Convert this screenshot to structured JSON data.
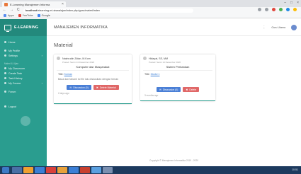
{
  "browser": {
    "tab_title": "E-Learning Manajemen Informa",
    "tab_close": "×",
    "window_controls": [
      "–",
      "□",
      "×"
    ],
    "nav": [
      "←",
      "→",
      "C"
    ],
    "url_host": "localhost",
    "url_path": "/elearning-mi-siswa/ajax/index.php/guru/materi/index",
    "bookmarks": [
      "Apps",
      "YouTube",
      "Google"
    ],
    "ext_colors": [
      "#9aa0a6",
      "#9aa0a6",
      "#e0463c",
      "#4caf50",
      "#1e88e5",
      "#fbbc04"
    ]
  },
  "sidebar": {
    "logo_text": "E-LEARNING",
    "items_top": [
      {
        "label": "Home"
      }
    ],
    "group_personal": [
      {
        "label": "My Profile"
      },
      {
        "label": "Settings"
      }
    ],
    "group_head": "Materi & Ujian",
    "group_learning": [
      {
        "label": "My Classroom"
      },
      {
        "label": "Create Task"
      },
      {
        "label": "Task History"
      },
      {
        "label": "My Course"
      }
    ],
    "items_misc": [
      {
        "label": "Forum"
      }
    ],
    "items_bottom": [
      {
        "label": "Logout"
      }
    ],
    "chevron": "›"
  },
  "topbar": {
    "title": "MANAJEMEN INFORMATIKA",
    "menu": "⋮",
    "user_name": "Guru Utama"
  },
  "main": {
    "page_title": "Material"
  },
  "cards": [
    {
      "author": "Nashrudin Zidan, M.Kom",
      "date": "Posted: Senin 14 Desember 2020",
      "subject": "Komputer dan Masyarakat",
      "file_label": "Title:",
      "file_link": "Komas",
      "desc": "Baca dan fahami isi file lalu diskusikan dengan teman",
      "btn_primary": "Discussion (0)",
      "btn_danger": "Delete Material",
      "time": "2 days ago"
    },
    {
      "author": "Hidayat, SE, MM",
      "date": "Posted: Senin 14 Desember 2020",
      "subject": "Sistem Perbankan",
      "file_label": "Title:",
      "file_link": "Modul 1",
      "desc": "",
      "btn_primary": "Discussion (0)",
      "btn_danger": "Delete",
      "time": "3 months ago"
    }
  ],
  "footer": {
    "text": "Copyright © Manajemen Informatika 2019 - 2020"
  },
  "taskbar": {
    "icon_colors": [
      "#4a6fa5",
      "#f0a030",
      "#3b7fd6",
      "#d9413b",
      "#e8a13a",
      "#3b7fd6",
      "#c8402f",
      "#5aa0e0",
      "#7a8fb0"
    ],
    "time": "10:51"
  },
  "colors": {
    "accent": "#2a9d8f",
    "primary_button": "#4a7fd6",
    "danger_button": "#e06767"
  }
}
